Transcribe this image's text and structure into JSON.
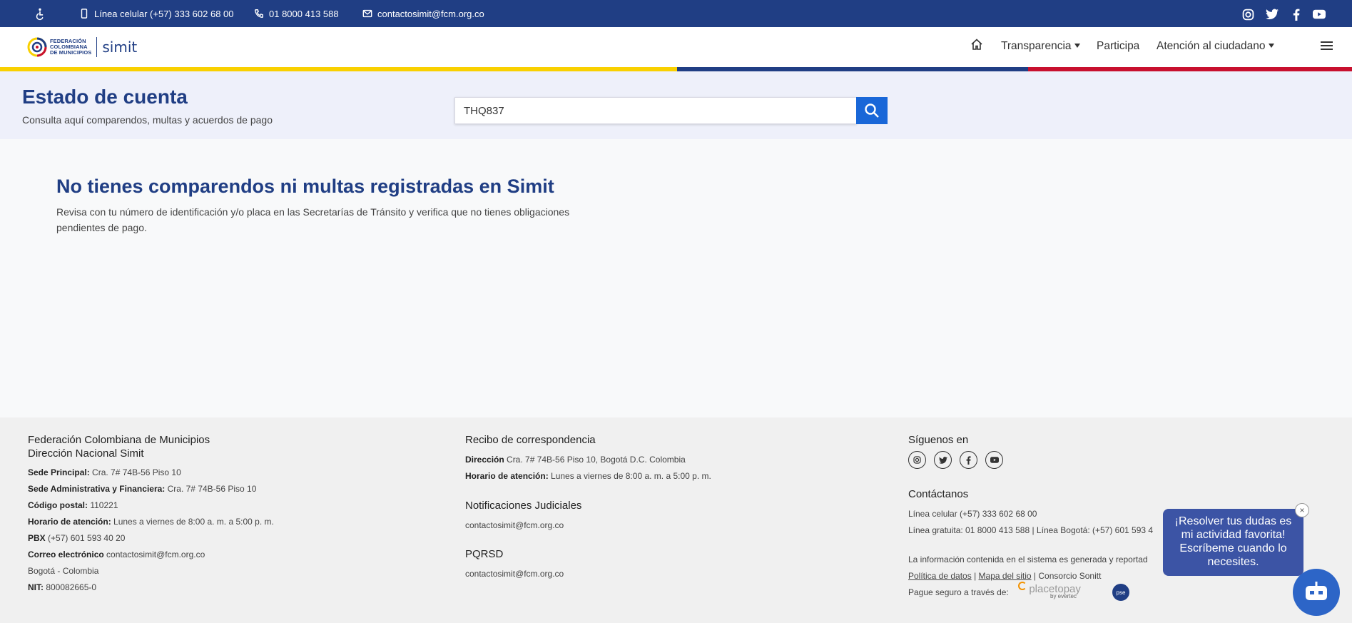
{
  "topbar": {
    "accessibility_icon": "wheelchair-icon",
    "phone_mobile": "Línea celular (+57) 333 602 68 00",
    "phone_line": "01 8000 413 588",
    "email": "contactosimit@fcm.org.co",
    "social": [
      "instagram-icon",
      "twitter-icon",
      "facebook-icon",
      "youtube-icon"
    ]
  },
  "header": {
    "logo_text_1": "FEDERACIÓN",
    "logo_text_2": "COLOMBIANA",
    "logo_text_3": "DE MUNICIPIOS",
    "logo_brand": "simit",
    "nav": {
      "home_icon": "home-icon",
      "transparencia": "Transparencia",
      "participa": "Participa",
      "atencion": "Atención al ciudadano",
      "menu_icon": "hamburger-icon"
    }
  },
  "band": {
    "title": "Estado de cuenta",
    "subtitle": "Consulta aquí comparendos, multas y acuerdos de pago",
    "search_value": "THQ837"
  },
  "message": {
    "title": "No tienes comparendos ni multas registradas en Simit",
    "text": "Revisa con tu número de identificación y/o placa en las Secretarías de Tránsito y verifica que no tienes obligaciones pendientes de pago."
  },
  "footer": {
    "col1": {
      "org_1": "Federación Colombiana de Municipios",
      "org_2": "Dirección Nacional Simit",
      "sede_principal_label": "Sede Principal:",
      "sede_principal": " Cra. 7# 74B-56 Piso 10",
      "sede_admin_label": "Sede Administrativa y Financiera:",
      "sede_admin": " Cra. 7# 74B-56 Piso 10",
      "postal_label": "Código postal:",
      "postal": " 110221",
      "horario_label": "Horario de atención:",
      "horario": " Lunes a viernes de 8:00 a. m. a 5:00 p. m.",
      "pbx_label": "PBX",
      "pbx": " (+57) 601 593 40 20",
      "correo_label": "Correo electrónico",
      "correo": " contactosimit@fcm.org.co",
      "ciudad": "Bogotá - Colombia",
      "nit_label": "NIT:",
      "nit": " 800082665-0"
    },
    "col2": {
      "recibo_title": "Recibo de correspondencia",
      "direccion_label": "Dirección",
      "direccion": " Cra. 7# 74B-56 Piso 10, Bogotá D.C. Colombia",
      "horario_label": "Horario de atención:",
      "horario": " Lunes a viernes de 8:00 a. m. a 5:00 p. m.",
      "notif_title": "Notificaciones Judiciales",
      "notif_email": "contactosimit@fcm.org.co",
      "pqrsd_title": "PQRSD",
      "pqrsd_email": "contactosimit@fcm.org.co"
    },
    "col3": {
      "siguenos": "Síguenos en",
      "contactanos": "Contáctanos",
      "linea_celular": "Línea celular (+57) 333 602 68 00",
      "linea_gratuita": "Línea gratuita: 01 8000 413 588 | Línea Bogotá: (+57) 601 593 4",
      "info": "La información contenida en el sistema es generada y reportad",
      "politica": "Política de datos",
      "mapa": "Mapa del sitio",
      "consorcio": "Consorcio Sonitt",
      "pague": "Pague seguro a través de:",
      "placetopay": "placetopay",
      "evertec": "by evertec",
      "pse": "pse"
    }
  },
  "chat": {
    "line1": "¡Resolver tus dudas es",
    "line2": "mi actividad favorita!",
    "line3": "Escríbeme cuando lo",
    "line4": "necesites.",
    "close": "×"
  },
  "colors": {
    "primary": "#203e84",
    "accent_blue": "#1967d8",
    "yellow": "#f9d000",
    "red": "#c8102e"
  }
}
